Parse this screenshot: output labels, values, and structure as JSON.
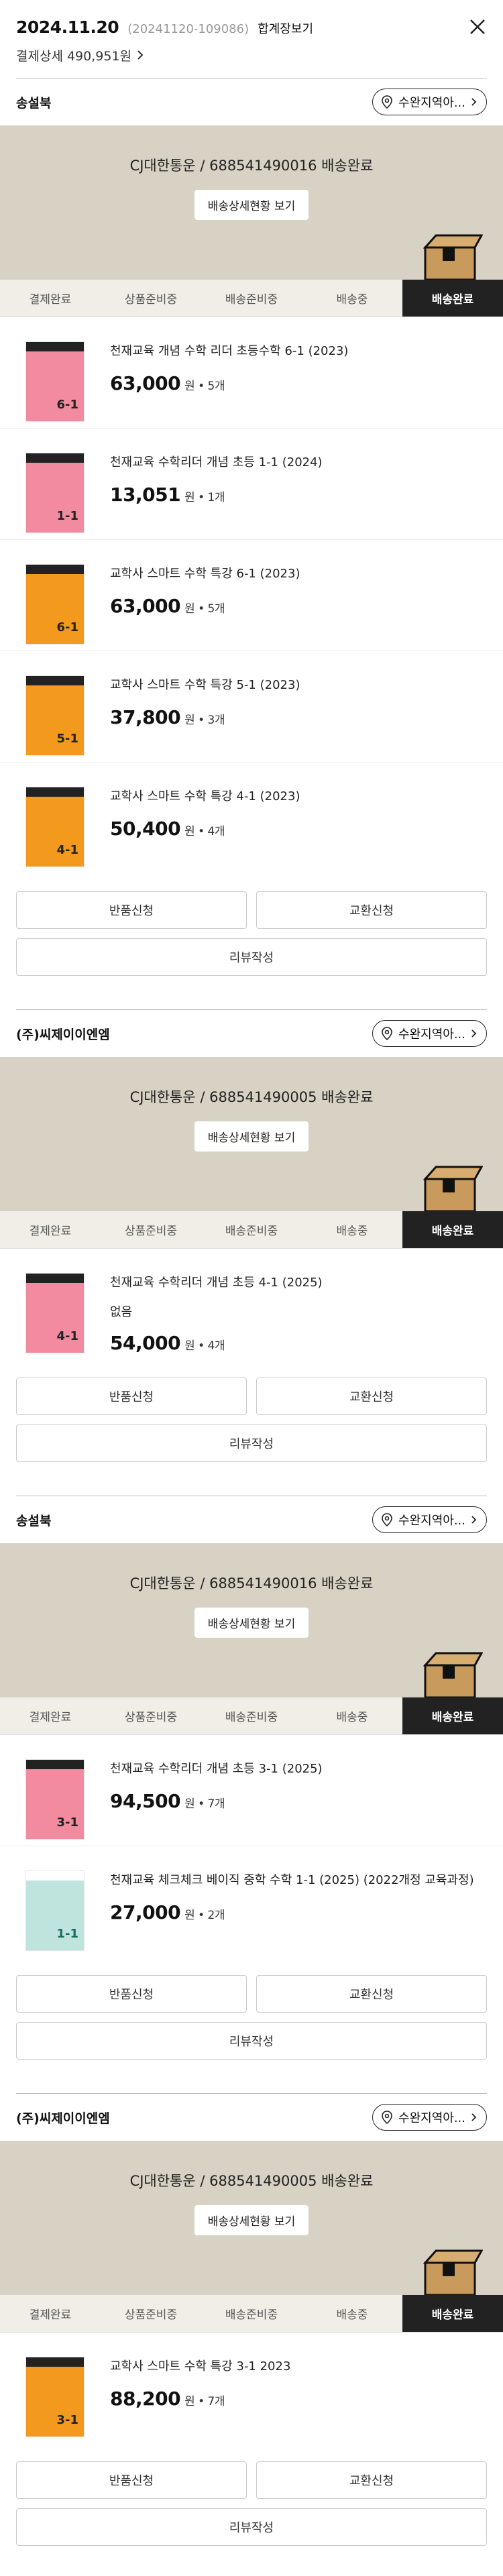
{
  "header": {
    "date": "2024.11.20",
    "order_no": "(20241120-109086)",
    "receipt_label": "합계장보기",
    "payment_label": "결제상세 490,951원"
  },
  "ui": {
    "track_button": "배송상세현황 보기",
    "return_button": "반품신청",
    "exchange_button": "교환신청",
    "review_button": "리뷰작성",
    "dest_label": "수완지역아...",
    "steps": [
      "결제완료",
      "상품준비중",
      "배송준비중",
      "배송중",
      "배송완료"
    ],
    "qty_sep": "원 •"
  },
  "colors": {
    "ship_bg": "#d7d2c3",
    "step_active_bg": "#222222",
    "book_pink": "#f28aa0",
    "book_orange": "#f39a1e",
    "book_mint": "#bfe3dd"
  },
  "shipments": [
    {
      "seller": "송설북",
      "carrier": "CJ대한통운 / 688541490016 배송완료",
      "items": [
        {
          "title": "천재교육 개념 수학 리더 초등수학 6-1 (2023)",
          "price": "63,000",
          "qty": "5개",
          "cover": "pink",
          "cover_num": "6-1"
        },
        {
          "title": "천재교육 수학리더 개념 초등 1-1 (2024)",
          "price": "13,051",
          "qty": "1개",
          "cover": "pink",
          "cover_num": "1-1"
        },
        {
          "title": "교학사 스마트 수학 특강 6-1 (2023)",
          "price": "63,000",
          "qty": "5개",
          "cover": "orange",
          "cover_num": "6-1"
        },
        {
          "title": "교학사 스마트 수학 특강 5-1 (2023)",
          "price": "37,800",
          "qty": "3개",
          "cover": "orange",
          "cover_num": "5-1"
        },
        {
          "title": "교학사 스마트 수학 특강 4-1 (2023)",
          "price": "50,400",
          "qty": "4개",
          "cover": "orange",
          "cover_num": "4-1"
        }
      ]
    },
    {
      "seller": "(주)씨제이이엔엠",
      "carrier": "CJ대한통운 / 688541490005 배송완료",
      "items": [
        {
          "title": "천재교육 수학리더 개념 초등 4-1 (2025)",
          "option": "없음",
          "price": "54,000",
          "qty": "4개",
          "cover": "pink",
          "cover_num": "4-1"
        }
      ]
    },
    {
      "seller": "송설북",
      "carrier": "CJ대한통운 / 688541490016 배송완료",
      "items": [
        {
          "title": "천재교육 수학리더 개념 초등 3-1 (2025)",
          "price": "94,500",
          "qty": "7개",
          "cover": "pink",
          "cover_num": "3-1"
        },
        {
          "title": "천재교육 체크체크 베이직 중학 수학 1-1 (2025) (2022개정 교육과정)",
          "price": "27,000",
          "qty": "2개",
          "cover": "mint",
          "cover_num": "1-1"
        }
      ]
    },
    {
      "seller": "(주)씨제이이엔엠",
      "carrier": "CJ대한통운 / 688541490005 배송완료",
      "items": [
        {
          "title": "교학사 스마트 수학 특강 3-1 2023",
          "price": "88,200",
          "qty": "7개",
          "cover": "orange",
          "cover_num": "3-1"
        }
      ]
    }
  ]
}
